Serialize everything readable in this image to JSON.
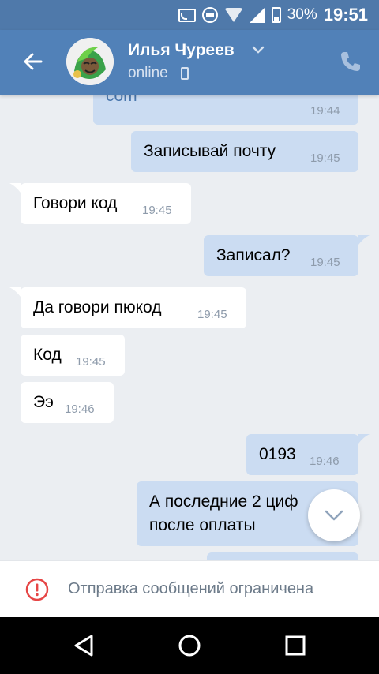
{
  "status_bar": {
    "battery_percent": "30%",
    "time": "19:51"
  },
  "header": {
    "contact_name": "Илья Чуреев",
    "status": "online"
  },
  "messages": [
    {
      "direction": "out",
      "text": "com",
      "time": "19:44"
    },
    {
      "direction": "out",
      "text": "Записывай почту",
      "time": "19:45"
    },
    {
      "direction": "in",
      "text": "Говори код",
      "time": "19:45"
    },
    {
      "direction": "out",
      "text": "Записал?",
      "time": "19:45"
    },
    {
      "direction": "in",
      "text": "Да говори пюкод",
      "time": "19:45"
    },
    {
      "direction": "in",
      "text": "Код",
      "time": "19:45"
    },
    {
      "direction": "in",
      "text": "Ээ",
      "time": "19:46"
    },
    {
      "direction": "out",
      "text": "0193",
      "time": "19:46"
    },
    {
      "direction": "out",
      "text_line1": "А последние 2 циф",
      "text_line2": "после  оплаты",
      "time": ""
    }
  ],
  "restriction": {
    "text": "Отправка сообщений ограничена"
  },
  "colors": {
    "header": "#5181b8",
    "outgoing_bubble": "#cbdcf2",
    "incoming_bubble": "#ffffff",
    "warning": "#e64646"
  }
}
